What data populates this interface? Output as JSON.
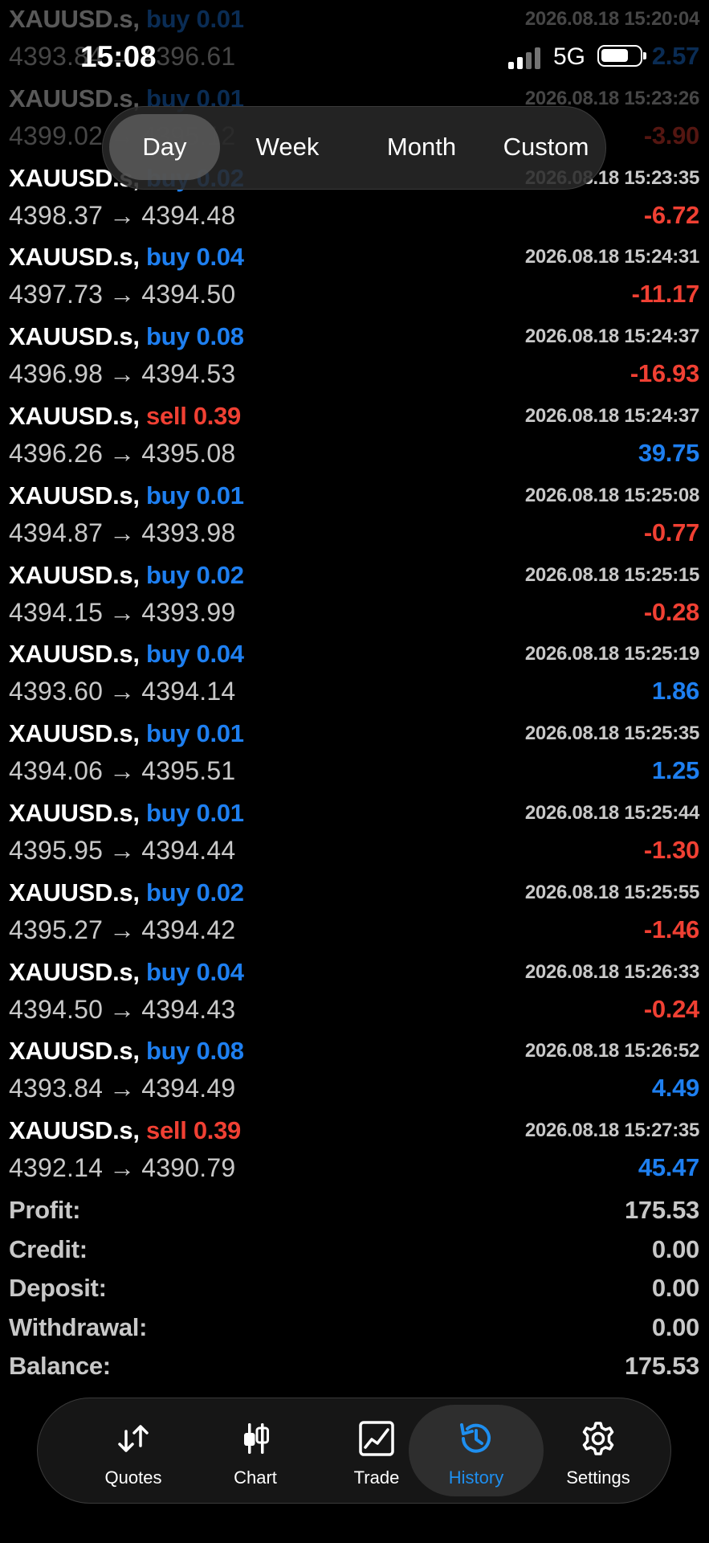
{
  "status_bar": {
    "time": "15:08",
    "network": "5G"
  },
  "period": {
    "options": [
      "Day",
      "Week",
      "Month",
      "Custom"
    ],
    "selected": "Day"
  },
  "trades": [
    {
      "symbol": "XAUUSD.s,",
      "action": "buy",
      "volume": "0.01",
      "time": "2026.08.18 15:20:04",
      "open": "4393.84",
      "close": "4396.61",
      "profit": "2.57",
      "sign": "pos"
    },
    {
      "symbol": "XAUUSD.s,",
      "action": "buy",
      "volume": "0.01",
      "time": "2026.08.18 15:23:26",
      "open": "4399.02",
      "close": "4395.12",
      "profit": "-3.90",
      "sign": "neg"
    },
    {
      "symbol": "XAUUSD.s,",
      "action": "buy",
      "volume": "0.02",
      "time": "2026.08.18 15:23:35",
      "open": "4398.37",
      "close": "4394.48",
      "profit": "-6.72",
      "sign": "neg"
    },
    {
      "symbol": "XAUUSD.s,",
      "action": "buy",
      "volume": "0.04",
      "time": "2026.08.18 15:24:31",
      "open": "4397.73",
      "close": "4394.50",
      "profit": "-11.17",
      "sign": "neg"
    },
    {
      "symbol": "XAUUSD.s,",
      "action": "buy",
      "volume": "0.08",
      "time": "2026.08.18 15:24:37",
      "open": "4396.98",
      "close": "4394.53",
      "profit": "-16.93",
      "sign": "neg"
    },
    {
      "symbol": "XAUUSD.s,",
      "action": "sell",
      "volume": "0.39",
      "time": "2026.08.18 15:24:37",
      "open": "4396.26",
      "close": "4395.08",
      "profit": "39.75",
      "sign": "pos"
    },
    {
      "symbol": "XAUUSD.s,",
      "action": "buy",
      "volume": "0.01",
      "time": "2026.08.18 15:25:08",
      "open": "4394.87",
      "close": "4393.98",
      "profit": "-0.77",
      "sign": "neg"
    },
    {
      "symbol": "XAUUSD.s,",
      "action": "buy",
      "volume": "0.02",
      "time": "2026.08.18 15:25:15",
      "open": "4394.15",
      "close": "4393.99",
      "profit": "-0.28",
      "sign": "neg"
    },
    {
      "symbol": "XAUUSD.s,",
      "action": "buy",
      "volume": "0.04",
      "time": "2026.08.18 15:25:19",
      "open": "4393.60",
      "close": "4394.14",
      "profit": "1.86",
      "sign": "pos"
    },
    {
      "symbol": "XAUUSD.s,",
      "action": "buy",
      "volume": "0.01",
      "time": "2026.08.18 15:25:35",
      "open": "4394.06",
      "close": "4395.51",
      "profit": "1.25",
      "sign": "pos"
    },
    {
      "symbol": "XAUUSD.s,",
      "action": "buy",
      "volume": "0.01",
      "time": "2026.08.18 15:25:44",
      "open": "4395.95",
      "close": "4394.44",
      "profit": "-1.30",
      "sign": "neg"
    },
    {
      "symbol": "XAUUSD.s,",
      "action": "buy",
      "volume": "0.02",
      "time": "2026.08.18 15:25:55",
      "open": "4395.27",
      "close": "4394.42",
      "profit": "-1.46",
      "sign": "neg"
    },
    {
      "symbol": "XAUUSD.s,",
      "action": "buy",
      "volume": "0.04",
      "time": "2026.08.18 15:26:33",
      "open": "4394.50",
      "close": "4394.43",
      "profit": "-0.24",
      "sign": "neg"
    },
    {
      "symbol": "XAUUSD.s,",
      "action": "buy",
      "volume": "0.08",
      "time": "2026.08.18 15:26:52",
      "open": "4393.84",
      "close": "4394.49",
      "profit": "4.49",
      "sign": "pos"
    },
    {
      "symbol": "XAUUSD.s,",
      "action": "sell",
      "volume": "0.39",
      "time": "2026.08.18 15:27:35",
      "open": "4392.14",
      "close": "4390.79",
      "profit": "45.47",
      "sign": "pos"
    }
  ],
  "arrow_glyph": "→",
  "summary": [
    {
      "label": "Profit:",
      "value": "175.53"
    },
    {
      "label": "Credit:",
      "value": "0.00"
    },
    {
      "label": "Deposit:",
      "value": "0.00"
    },
    {
      "label": "Withdrawal:",
      "value": "0.00"
    },
    {
      "label": "Balance:",
      "value": "175.53"
    }
  ],
  "tabs": [
    {
      "label": "Quotes",
      "icon": "quotes-arrows-icon"
    },
    {
      "label": "Chart",
      "icon": "candlestick-icon"
    },
    {
      "label": "Trade",
      "icon": "trade-chart-icon"
    },
    {
      "label": "History",
      "icon": "history-clock-icon"
    },
    {
      "label": "Settings",
      "icon": "gear-icon"
    }
  ],
  "active_tab": "History",
  "colors": {
    "buy": "#1e7ff0",
    "sell": "#f04033",
    "profit_pos": "#1e7ff0",
    "profit_neg": "#f04033",
    "active_tab": "#1e8ff0"
  }
}
